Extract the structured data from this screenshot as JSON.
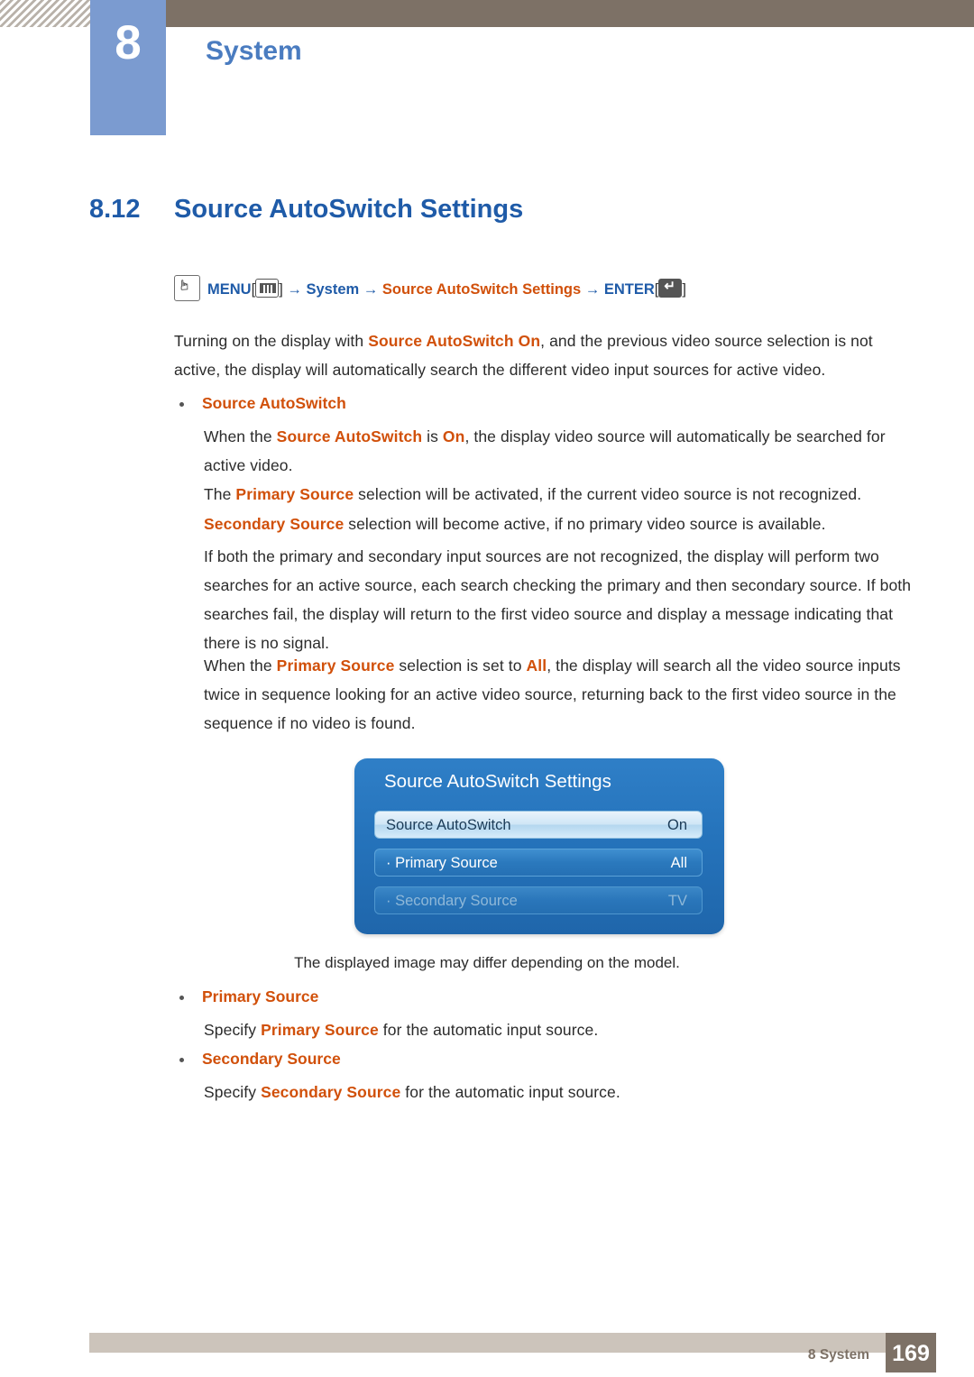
{
  "header": {
    "chapter_number": "8",
    "chapter_title": "System"
  },
  "section": {
    "number": "8.12",
    "title": "Source AutoSwitch Settings"
  },
  "menu_path": {
    "hand_icon": "hand-pointer-icon",
    "menu_label": "MENU",
    "menu_icon": "menu-key-icon",
    "arrow1": "→",
    "item1": "System",
    "arrow2": "→",
    "item2": "Source AutoSwitch Settings",
    "arrow3": "→",
    "enter_label": "ENTER",
    "enter_icon": "enter-key-icon",
    "bracket_open": "[",
    "bracket_close": "]"
  },
  "intro": {
    "line1_a": "Turning on the display with ",
    "line1_hl": "Source AutoSwitch On",
    "line1_b": ", and the previous video source selection is not",
    "line2": "active, the display will automatically search the different video input sources for active video."
  },
  "bullets": {
    "source_autoswitch": {
      "label": "Source AutoSwitch",
      "p1_a": "When the ",
      "p1_hl1": "Source AutoSwitch",
      "p1_b": " is ",
      "p1_hl2": "On",
      "p1_c": ", the display video source will automatically be searched for",
      "p1_d": "active video.",
      "p2_a": "The ",
      "p2_hl": "Primary Source",
      "p2_b": " selection will be activated, if the current video source is not recognized.",
      "p3_hl": "Secondary Source",
      "p3_b": " selection will become active, if no primary video source is available.",
      "p4_l1": "If both the primary and secondary input sources are not recognized, the display will perform two",
      "p4_l2": "searches for an active source, each search checking the primary and then secondary source. If both",
      "p4_l3": "searches fail, the display will return to the first video source and display a message indicating that",
      "p4_l4": "there is no signal.",
      "p5_a": "When the ",
      "p5_hl1": "Primary Source",
      "p5_b": " selection is set to ",
      "p5_hl2": "All",
      "p5_c": ", the display will search all the video source inputs",
      "p5_l2": "twice in sequence looking for an active video source, returning back to the first video source in the",
      "p5_l3": "sequence if no video is found."
    },
    "primary_source": {
      "label": "Primary Source",
      "desc_a": "Specify ",
      "desc_hl": "Primary Source",
      "desc_b": " for the automatic input source."
    },
    "secondary_source": {
      "label": "Secondary Source",
      "desc_a": "Specify ",
      "desc_hl": "Secondary Source",
      "desc_b": " for the automatic input source."
    }
  },
  "osd": {
    "title": "Source AutoSwitch Settings",
    "rows": [
      {
        "label": "Source AutoSwitch",
        "value": "On"
      },
      {
        "label": "· Primary Source",
        "value": "All"
      },
      {
        "label": "· Secondary Source",
        "value": "TV"
      }
    ],
    "caption": "The displayed image may differ depending on the model."
  },
  "footer": {
    "text": "8 System",
    "page": "169"
  },
  "colors": {
    "accent_blue": "#1f5ba8",
    "accent_orange": "#d1500a",
    "header_brown": "#7d7166",
    "chapter_blue": "#7b9bd0"
  }
}
